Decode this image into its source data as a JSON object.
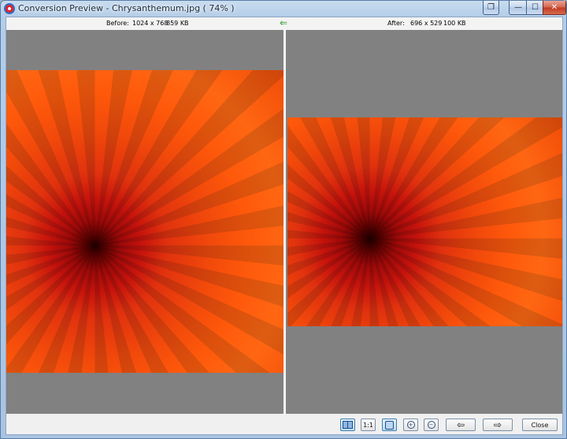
{
  "window": {
    "title": "Conversion Preview - Chrysanthemum.jpg  ( 74% )",
    "restore_glyph": "❐",
    "minimize_glyph": "—",
    "maximize_glyph": "☐",
    "close_glyph": "✕"
  },
  "info": {
    "before_label": "Before:",
    "before_dims": "1024 x 768",
    "before_size": "859 KB",
    "after_label": "After:",
    "after_dims": "696 x 529",
    "after_size": "100 KB",
    "arrow_glyph": "⇐"
  },
  "toolbar": {
    "one_to_one_label": "1:1",
    "zoom_in_glyph": "+",
    "zoom_out_glyph": "−",
    "prev_glyph": "⇦",
    "next_glyph": "⇨",
    "close_label": "Close"
  },
  "icons": {
    "side_by_side": "side-by-side-icon",
    "fit": "fit-to-window-icon",
    "zoom_in": "zoom-in-icon",
    "zoom_out": "zoom-out-icon",
    "prev": "arrow-left-icon",
    "next": "arrow-right-icon"
  },
  "colors": {
    "pane_background": "#818181",
    "arrow": "#2c9a2c",
    "active_button": "#bcdcf3"
  }
}
